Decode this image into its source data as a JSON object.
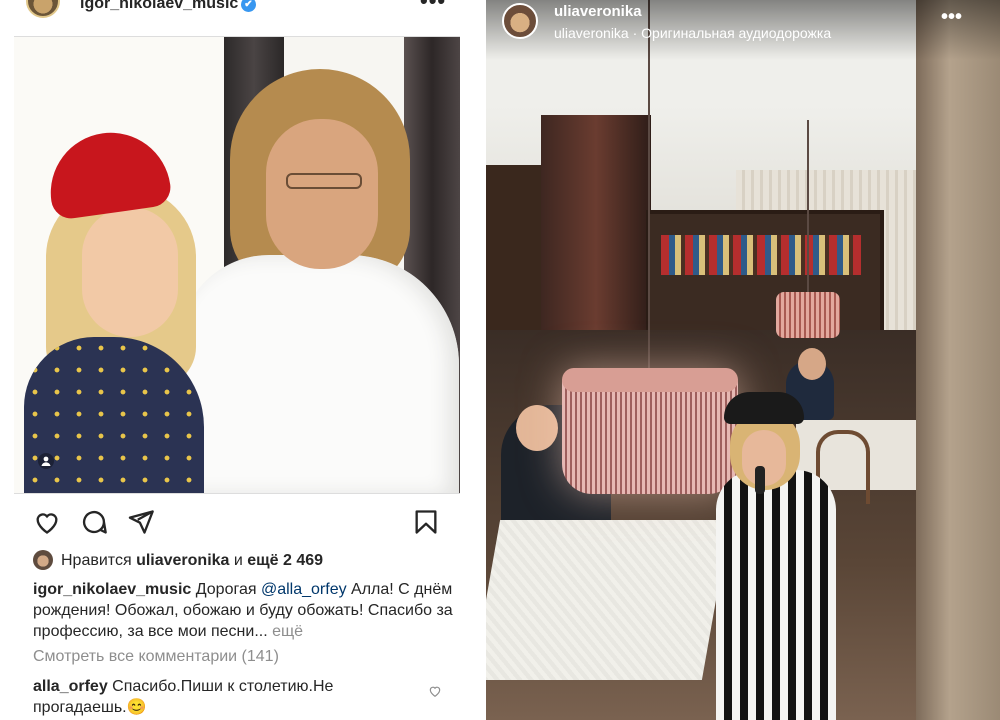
{
  "post": {
    "username": "igor_nikolaev_music",
    "verified_mark": "✔",
    "more_icon": "•••",
    "icons": {
      "like": "heart-icon",
      "comment": "comment-bubble-icon",
      "share": "send-arrow-icon",
      "save": "bookmark-icon",
      "tagged": "person-tag-icon"
    },
    "likes": {
      "prefix": "Нравится",
      "user": "uliaveronika",
      "middle": "и",
      "rest": "ещё 2 469"
    },
    "caption": {
      "author": "igor_nikolaev_music",
      "text_before": "Дорогая",
      "mention": "@alla_orfey",
      "text_after": "Алла! С днём рождения! Обожал, обожаю и буду обожать! Спасибо за профессию, за все мои песни...",
      "more_label": "ещё"
    },
    "view_all_comments": "Смотреть все комментарии (141)",
    "comment": {
      "author": "alla_orfey",
      "text": "Спасибо.Пиши к столетию.Не прогадаешь.",
      "emoji": "😊"
    }
  },
  "story": {
    "username": "uliaveronika",
    "subtitle": "uliaveronika · Оригинальная аудиодорожка",
    "more_icon": "•••"
  },
  "colors": {
    "mention": "#00376b",
    "verified": "#3897f0",
    "muted": "#8e8e8e"
  }
}
